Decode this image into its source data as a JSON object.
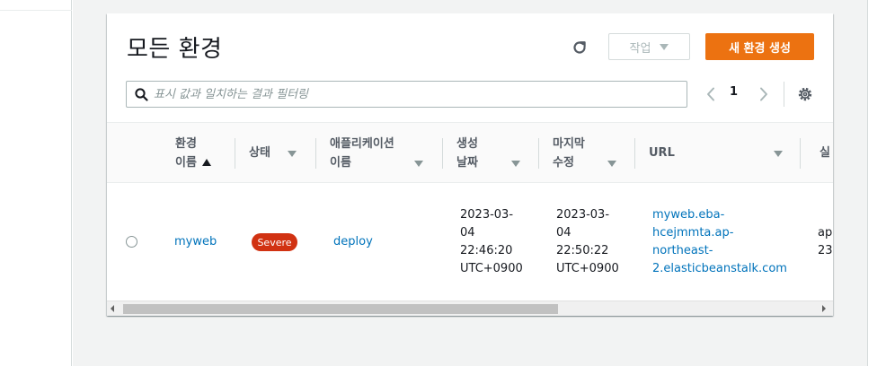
{
  "panel": {
    "title": "모든 환경",
    "actions_label": "작업",
    "create_label": "새 환경 생성"
  },
  "search": {
    "placeholder": "표시 값과 일치하는 결과 필터링",
    "value": ""
  },
  "pagination": {
    "current_page": "1"
  },
  "table": {
    "columns": [
      {
        "line1": "환경",
        "line2": "이름",
        "sort": "ascending"
      },
      {
        "line1": "상태",
        "line2": ""
      },
      {
        "line1": "애플리케이션",
        "line2": "이름"
      },
      {
        "line1": "생성",
        "line2": "날짜"
      },
      {
        "line1": "마지막",
        "line2": "수정"
      },
      {
        "line1": "URL",
        "line2": ""
      },
      {
        "line1": "실",
        "line2": ""
      }
    ],
    "rows": [
      {
        "environment_name": "myweb",
        "status": "Severe",
        "application_name": "deploy",
        "created": [
          "2023-03-",
          "04",
          "22:46:20",
          "UTC+0900"
        ],
        "modified": [
          "2023-03-",
          "04",
          "22:50:22",
          "UTC+0900"
        ],
        "url": [
          "myweb.eba-",
          "hcejmmta.ap-",
          "northeast-",
          "2.elasticbeanstalk.com"
        ],
        "platform": [
          "ap",
          "23"
        ]
      }
    ]
  },
  "colors": {
    "primary_button": "#ec7211",
    "link": "#0073bb",
    "severe_badge": "#d13212"
  },
  "icons": [
    "refresh-icon",
    "caret-down-icon",
    "search-icon",
    "chevron-left-icon",
    "chevron-right-icon",
    "gear-icon",
    "sort-ascending-icon",
    "sort-icon"
  ]
}
